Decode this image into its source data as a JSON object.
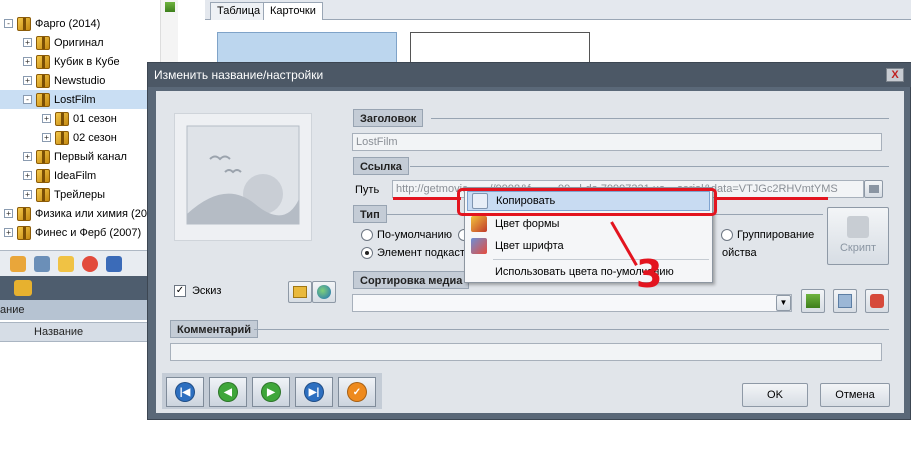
{
  "tree": {
    "items": [
      {
        "label": "Фарго (2014)",
        "level": 0,
        "exp": "-"
      },
      {
        "label": "Оригинал",
        "level": 1,
        "exp": "+"
      },
      {
        "label": "Кубик в Кубе",
        "level": 1,
        "exp": "+"
      },
      {
        "label": "Newstudio",
        "level": 1,
        "exp": "+"
      },
      {
        "label": "LostFilm",
        "level": 1,
        "exp": "-"
      },
      {
        "label": "01 сезон",
        "level": 2,
        "exp": "+"
      },
      {
        "label": "02 сезон",
        "level": 2,
        "exp": "+"
      },
      {
        "label": "Первый канал",
        "level": 1,
        "exp": "+"
      },
      {
        "label": "IdeaFilm",
        "level": 1,
        "exp": "+"
      },
      {
        "label": "Трейлеры",
        "level": 1,
        "exp": "+"
      },
      {
        "label": "Физика или химия (20",
        "level": 0,
        "exp": "+"
      },
      {
        "label": "Финес и Ферб (2007)",
        "level": 0,
        "exp": "+"
      }
    ],
    "selected_index": 4
  },
  "left_panel": {
    "band_label": "ание",
    "column_header": "Название"
  },
  "tabs": [
    {
      "label": "Таблица"
    },
    {
      "label": "Карточки"
    }
  ],
  "dialog": {
    "title": "Изменить название/настройки",
    "close_label": "X",
    "thumbnail_label": "Эскиз",
    "sections": {
      "header": "Заголовок",
      "link": "Ссылка",
      "type": "Тип",
      "sort": "Сортировка медиа",
      "comment": "Комментарий"
    },
    "title_value": "LostFilm",
    "path_label": "Путь",
    "path_value": "http://getmovie.......//9998&f.........99...l-da.79997331.ua....serial&data=VTJGc2RHVmtYMS",
    "type_options": [
      {
        "label": "По-умолчанию",
        "selected": false
      },
      {
        "label": "Элемент подкаст",
        "selected": true
      },
      {
        "label": "Группирование",
        "selected": false
      },
      {
        "label": "ойства",
        "selected": false
      }
    ],
    "script_label": "Скрипт",
    "ok_label": "OK",
    "cancel_label": "Отмена"
  },
  "context_menu": {
    "items": [
      {
        "label": "Копировать",
        "icon": "copy-icon"
      },
      {
        "label": "Цвет формы",
        "icon": "paint-brush-icon"
      },
      {
        "label": "Цвет шрифта",
        "icon": "font-color-icon"
      },
      {
        "label": "Использовать цвета по-умолчанию",
        "icon": ""
      }
    ],
    "highlighted_index": 0
  },
  "annotation": {
    "number": "3",
    "color": "#e3141f"
  }
}
